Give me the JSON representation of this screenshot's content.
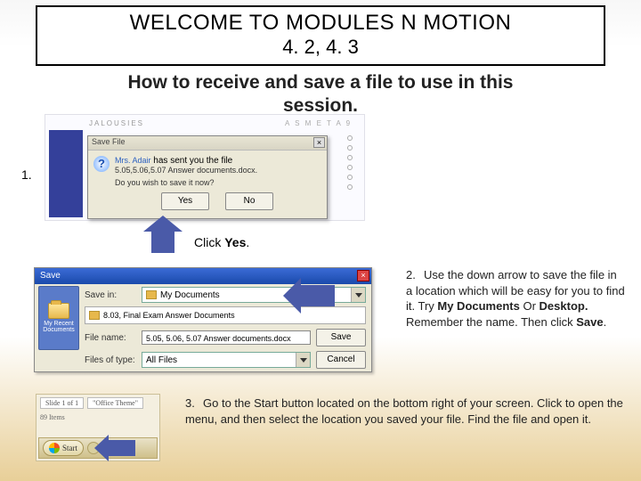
{
  "banner": {
    "line1": "WELCOME TO MODULES N MOTION",
    "line2": "4. 2, 4. 3"
  },
  "subtitle": {
    "line1": "How to receive and save a file to use in this",
    "line2": "session."
  },
  "step1": {
    "number": "1.",
    "bg_heading": "JALOUSIES",
    "bg_letters": "A  S  M  E  T  A  9",
    "dialog": {
      "title": "Save File",
      "sender": "Mrs. Adair",
      "sent_text": " has sent you the file",
      "filename": "5.05,5.06,5.07 Answer documents.docx.",
      "question": "Do you wish to save it now?",
      "yes": "Yes",
      "no": "No"
    },
    "caption_prefix": "Click ",
    "caption_bold": "Yes",
    "caption_suffix": "."
  },
  "step2": {
    "number": "2.",
    "dialog": {
      "title": "Save",
      "places_label": "My Recent Documents",
      "save_in_label": "Save in:",
      "save_in_value": "My Documents",
      "list_item": "8.03, Final Exam Answer Documents",
      "file_name_label": "File name:",
      "file_name_value": "5.05, 5.06, 5.07 Answer documents.docx",
      "file_type_label": "Files of type:",
      "file_type_value": "All Files",
      "save_btn": "Save",
      "cancel_btn": "Cancel"
    },
    "text_a": "Use the down arrow to save the file in a location which will be easy for you to find it.  Try ",
    "bold_a": "My Documents",
    "text_b": " Or ",
    "bold_b": "Desktop.",
    "text_c": "  Remember the name.  Then click ",
    "bold_c": "Save",
    "text_d": "."
  },
  "step3": {
    "number": "3.",
    "thumb": {
      "tab1": "Slide 1 of 1",
      "tab2": "\"Office Theme\"",
      "items": "89 Items",
      "start": "Start"
    },
    "text": "Go to the Start button located on the bottom right of your screen. Click to open the menu, and then select the location you saved your file. Find the file and open it."
  }
}
